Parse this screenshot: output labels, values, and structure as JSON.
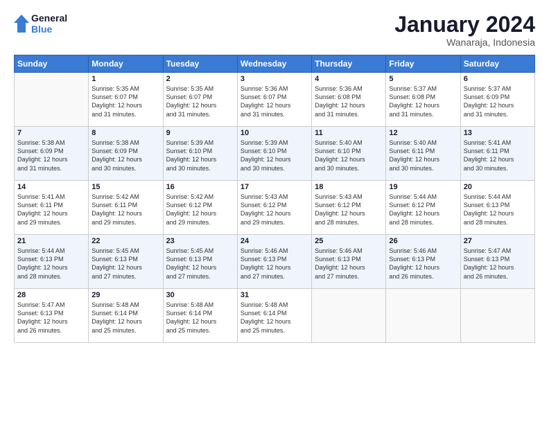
{
  "logo": {
    "line1": "General",
    "line2": "Blue"
  },
  "header": {
    "month": "January 2024",
    "location": "Wanaraja, Indonesia"
  },
  "weekdays": [
    "Sunday",
    "Monday",
    "Tuesday",
    "Wednesday",
    "Thursday",
    "Friday",
    "Saturday"
  ],
  "weeks": [
    [
      {
        "day": "",
        "info": ""
      },
      {
        "day": "1",
        "info": "Sunrise: 5:35 AM\nSunset: 6:07 PM\nDaylight: 12 hours\nand 31 minutes."
      },
      {
        "day": "2",
        "info": "Sunrise: 5:35 AM\nSunset: 6:07 PM\nDaylight: 12 hours\nand 31 minutes."
      },
      {
        "day": "3",
        "info": "Sunrise: 5:36 AM\nSunset: 6:07 PM\nDaylight: 12 hours\nand 31 minutes."
      },
      {
        "day": "4",
        "info": "Sunrise: 5:36 AM\nSunset: 6:08 PM\nDaylight: 12 hours\nand 31 minutes."
      },
      {
        "day": "5",
        "info": "Sunrise: 5:37 AM\nSunset: 6:08 PM\nDaylight: 12 hours\nand 31 minutes."
      },
      {
        "day": "6",
        "info": "Sunrise: 5:37 AM\nSunset: 6:09 PM\nDaylight: 12 hours\nand 31 minutes."
      }
    ],
    [
      {
        "day": "7",
        "info": "Sunrise: 5:38 AM\nSunset: 6:09 PM\nDaylight: 12 hours\nand 31 minutes."
      },
      {
        "day": "8",
        "info": "Sunrise: 5:38 AM\nSunset: 6:09 PM\nDaylight: 12 hours\nand 30 minutes."
      },
      {
        "day": "9",
        "info": "Sunrise: 5:39 AM\nSunset: 6:10 PM\nDaylight: 12 hours\nand 30 minutes."
      },
      {
        "day": "10",
        "info": "Sunrise: 5:39 AM\nSunset: 6:10 PM\nDaylight: 12 hours\nand 30 minutes."
      },
      {
        "day": "11",
        "info": "Sunrise: 5:40 AM\nSunset: 6:10 PM\nDaylight: 12 hours\nand 30 minutes."
      },
      {
        "day": "12",
        "info": "Sunrise: 5:40 AM\nSunset: 6:11 PM\nDaylight: 12 hours\nand 30 minutes."
      },
      {
        "day": "13",
        "info": "Sunrise: 5:41 AM\nSunset: 6:11 PM\nDaylight: 12 hours\nand 30 minutes."
      }
    ],
    [
      {
        "day": "14",
        "info": "Sunrise: 5:41 AM\nSunset: 6:11 PM\nDaylight: 12 hours\nand 29 minutes."
      },
      {
        "day": "15",
        "info": "Sunrise: 5:42 AM\nSunset: 6:11 PM\nDaylight: 12 hours\nand 29 minutes."
      },
      {
        "day": "16",
        "info": "Sunrise: 5:42 AM\nSunset: 6:12 PM\nDaylight: 12 hours\nand 29 minutes."
      },
      {
        "day": "17",
        "info": "Sunrise: 5:43 AM\nSunset: 6:12 PM\nDaylight: 12 hours\nand 29 minutes."
      },
      {
        "day": "18",
        "info": "Sunrise: 5:43 AM\nSunset: 6:12 PM\nDaylight: 12 hours\nand 28 minutes."
      },
      {
        "day": "19",
        "info": "Sunrise: 5:44 AM\nSunset: 6:12 PM\nDaylight: 12 hours\nand 28 minutes."
      },
      {
        "day": "20",
        "info": "Sunrise: 5:44 AM\nSunset: 6:13 PM\nDaylight: 12 hours\nand 28 minutes."
      }
    ],
    [
      {
        "day": "21",
        "info": "Sunrise: 5:44 AM\nSunset: 6:13 PM\nDaylight: 12 hours\nand 28 minutes."
      },
      {
        "day": "22",
        "info": "Sunrise: 5:45 AM\nSunset: 6:13 PM\nDaylight: 12 hours\nand 27 minutes."
      },
      {
        "day": "23",
        "info": "Sunrise: 5:45 AM\nSunset: 6:13 PM\nDaylight: 12 hours\nand 27 minutes."
      },
      {
        "day": "24",
        "info": "Sunrise: 5:46 AM\nSunset: 6:13 PM\nDaylight: 12 hours\nand 27 minutes."
      },
      {
        "day": "25",
        "info": "Sunrise: 5:46 AM\nSunset: 6:13 PM\nDaylight: 12 hours\nand 27 minutes."
      },
      {
        "day": "26",
        "info": "Sunrise: 5:46 AM\nSunset: 6:13 PM\nDaylight: 12 hours\nand 26 minutes."
      },
      {
        "day": "27",
        "info": "Sunrise: 5:47 AM\nSunset: 6:13 PM\nDaylight: 12 hours\nand 26 minutes."
      }
    ],
    [
      {
        "day": "28",
        "info": "Sunrise: 5:47 AM\nSunset: 6:13 PM\nDaylight: 12 hours\nand 26 minutes."
      },
      {
        "day": "29",
        "info": "Sunrise: 5:48 AM\nSunset: 6:14 PM\nDaylight: 12 hours\nand 25 minutes."
      },
      {
        "day": "30",
        "info": "Sunrise: 5:48 AM\nSunset: 6:14 PM\nDaylight: 12 hours\nand 25 minutes."
      },
      {
        "day": "31",
        "info": "Sunrise: 5:48 AM\nSunset: 6:14 PM\nDaylight: 12 hours\nand 25 minutes."
      },
      {
        "day": "",
        "info": ""
      },
      {
        "day": "",
        "info": ""
      },
      {
        "day": "",
        "info": ""
      }
    ]
  ],
  "row_classes": [
    "row-bg-1",
    "row-bg-2",
    "row-bg-1",
    "row-bg-2",
    "row-bg-1"
  ]
}
